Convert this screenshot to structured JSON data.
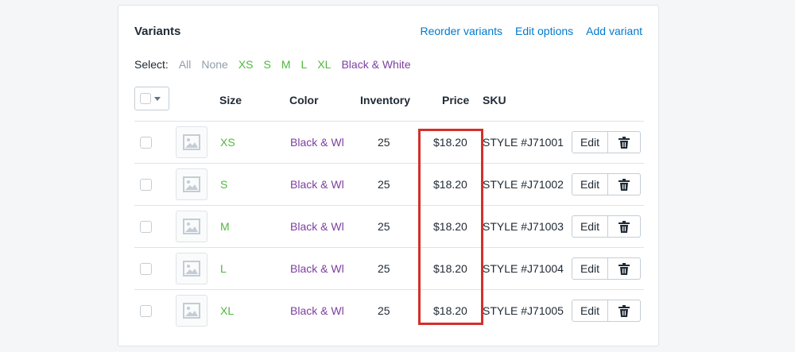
{
  "card": {
    "title": "Variants",
    "links": {
      "reorder": "Reorder variants",
      "edit_options": "Edit options",
      "add_variant": "Add variant"
    }
  },
  "select": {
    "label": "Select:",
    "options": {
      "all": "All",
      "none": "None",
      "xs": "XS",
      "s": "S",
      "m": "M",
      "l": "L",
      "xl": "XL",
      "color": "Black & White"
    }
  },
  "table": {
    "headers": {
      "size": "Size",
      "color": "Color",
      "inventory": "Inventory",
      "price": "Price",
      "sku": "SKU"
    },
    "edit_label": "Edit",
    "rows": [
      {
        "size": "XS",
        "color": "Black & Wl",
        "inventory": "25",
        "price": "$18.20",
        "sku": "STYLE #J71001"
      },
      {
        "size": "S",
        "color": "Black & Wl",
        "inventory": "25",
        "price": "$18.20",
        "sku": "STYLE #J71002"
      },
      {
        "size": "M",
        "color": "Black & Wl",
        "inventory": "25",
        "price": "$18.20",
        "sku": "STYLE #J71003"
      },
      {
        "size": "L",
        "color": "Black & Wl",
        "inventory": "25",
        "price": "$18.20",
        "sku": "STYLE #J71004"
      },
      {
        "size": "XL",
        "color": "Black & Wl",
        "inventory": "25",
        "price": "$18.20",
        "sku": "STYLE #J71005"
      }
    ]
  },
  "colors": {
    "link": "#007ace",
    "size_green": "#50b83c",
    "color_purple": "#7d3fa0",
    "highlight_red": "#d3302a"
  },
  "icons": {
    "image_placeholder": "image-icon",
    "delete": "trash-icon",
    "dropdown": "caret-down-icon"
  }
}
